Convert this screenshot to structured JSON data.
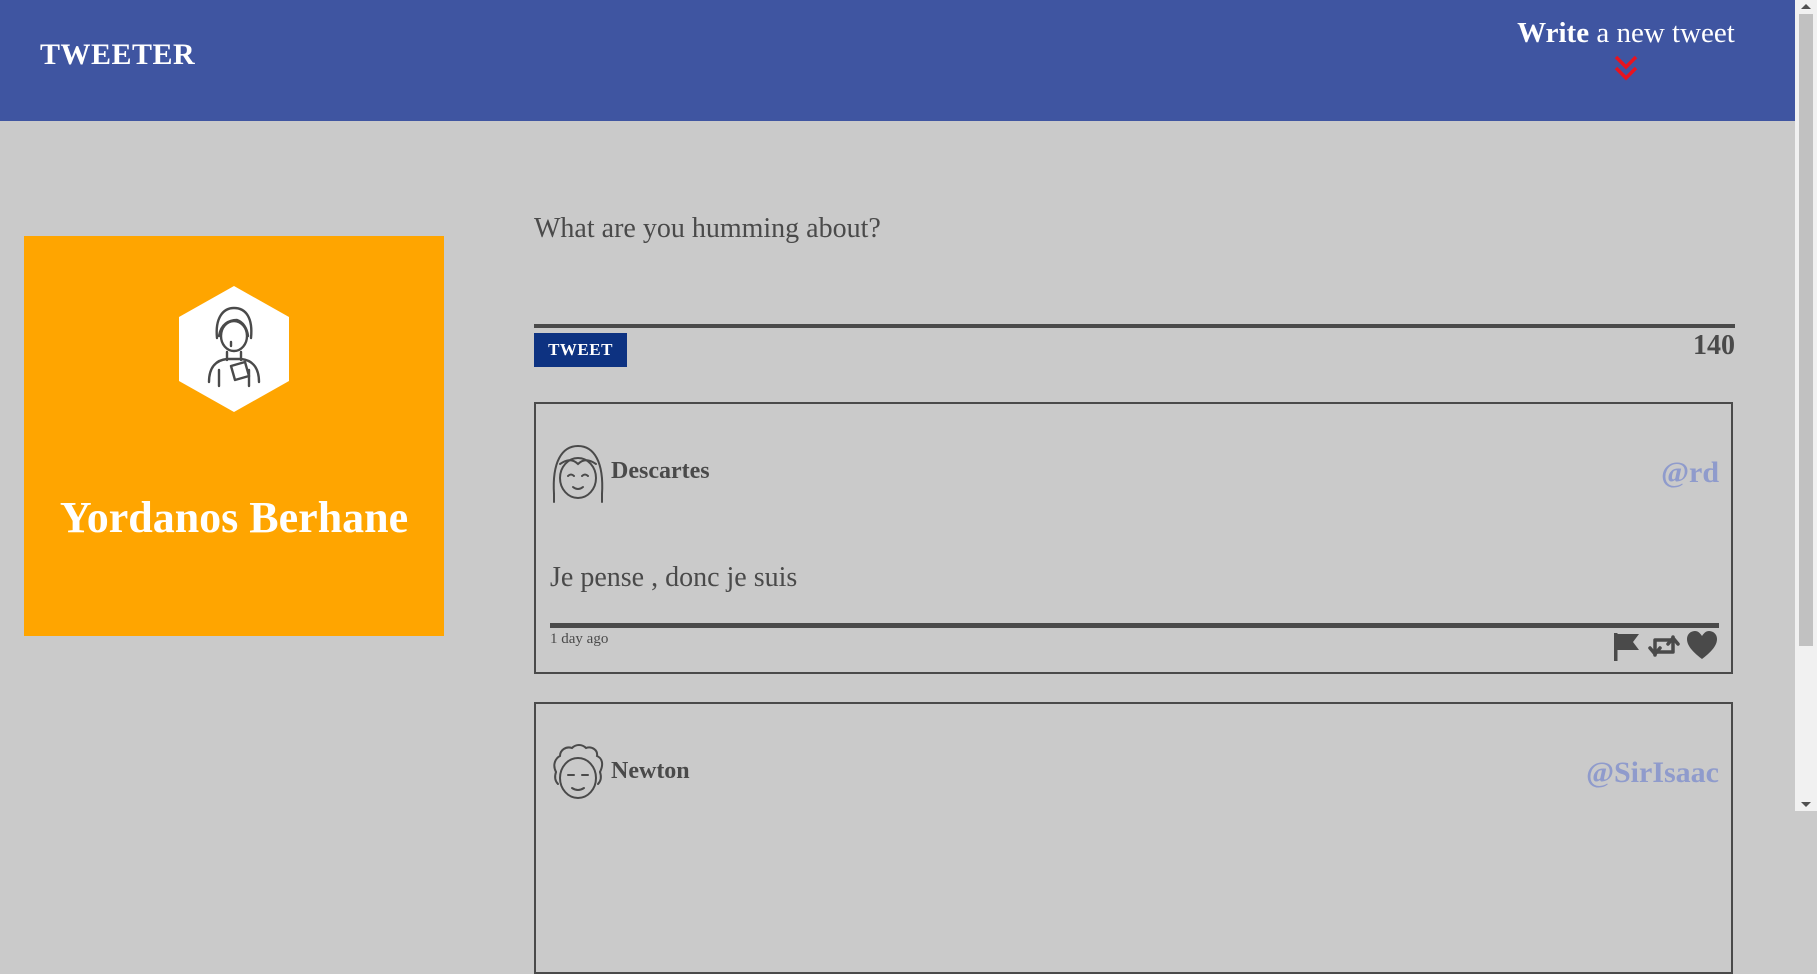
{
  "nav": {
    "brand": "TWEETER",
    "compose_strong": "Write",
    "compose_rest": " a new tweet",
    "compose_icon": "double-chevron-down-icon",
    "accent": "#e8131f"
  },
  "profile": {
    "name": "Yordanos Berhane",
    "avatar_icon": "user-avatar-icon",
    "background": "#ffa500"
  },
  "composer": {
    "placeholder": "What are you humming about?",
    "button_label": "TWEET",
    "counter": "140"
  },
  "tweets": [
    {
      "author": "Descartes",
      "handle": "@rd",
      "text": "Je pense , donc je suis",
      "time": "1 day ago",
      "avatar_icon": "avatar-icon",
      "actions": [
        "flag-icon",
        "retweet-icon",
        "heart-icon"
      ]
    },
    {
      "author": "Newton",
      "handle": "@SirIsaac",
      "avatar_icon": "avatar-icon"
    }
  ],
  "colors": {
    "nav": "#3f55a1",
    "page": "#cacaca",
    "text": "#4a4a4a",
    "handle": "#8f9bcc",
    "button": "#0d3281"
  }
}
